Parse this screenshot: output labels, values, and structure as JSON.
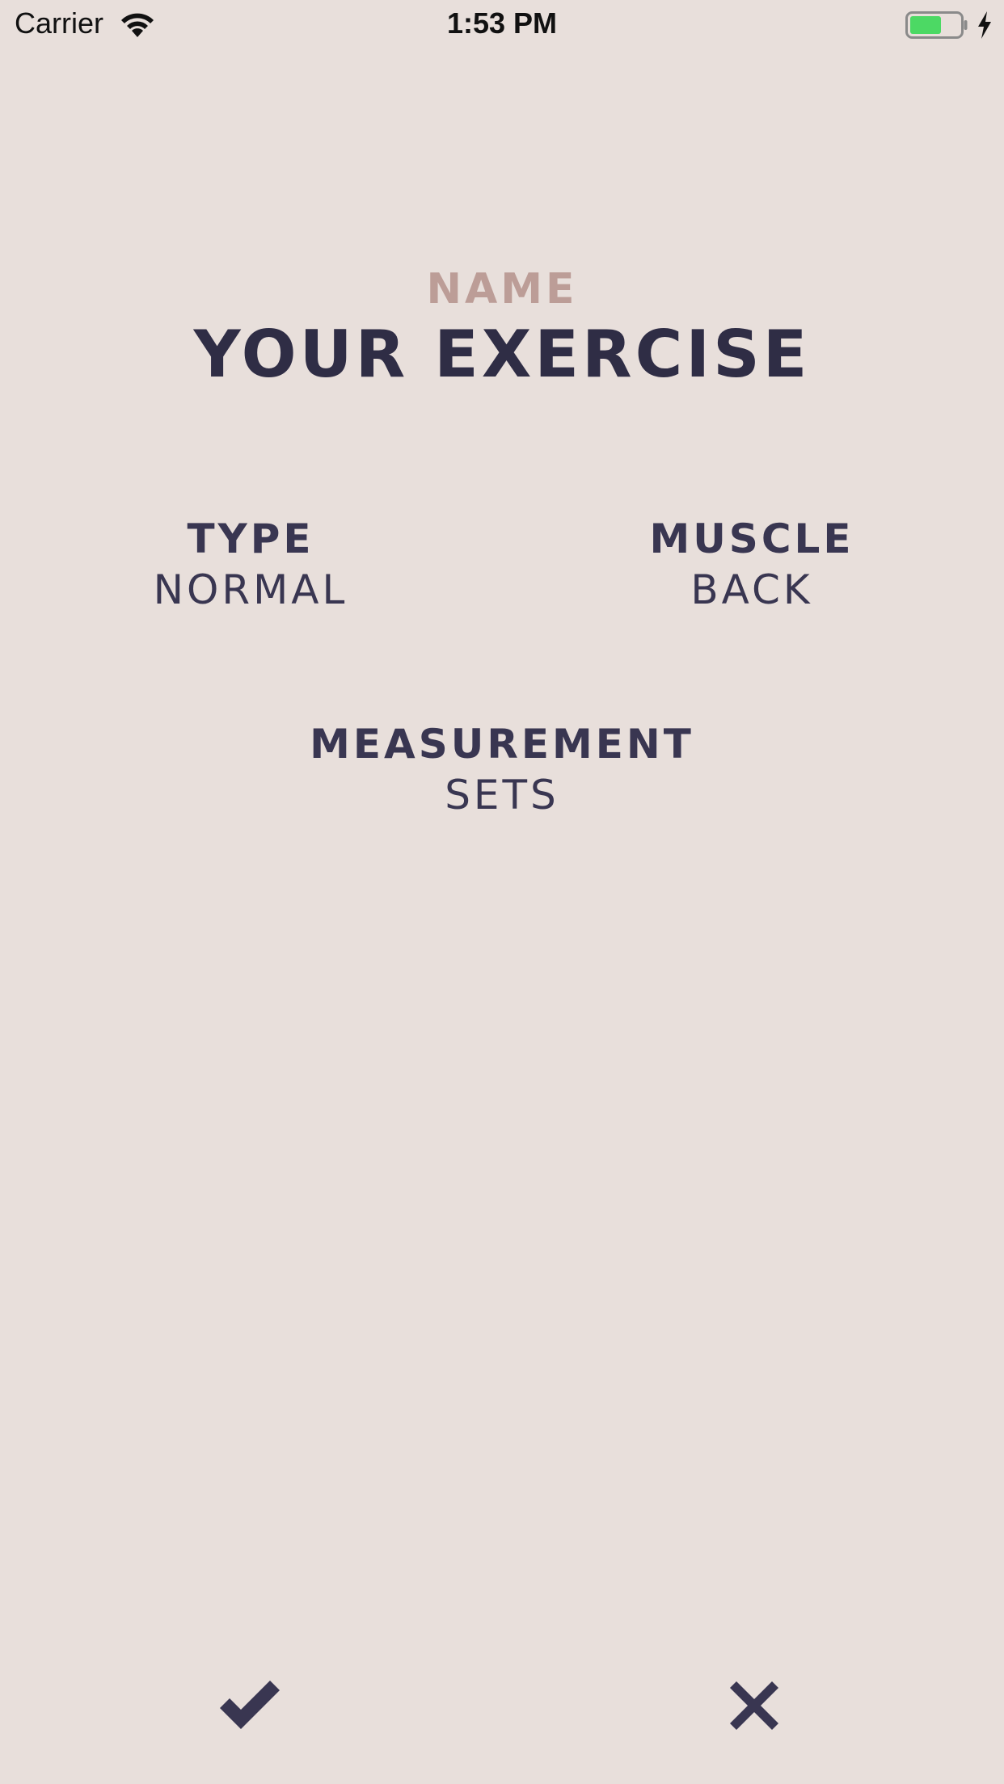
{
  "status_bar": {
    "carrier": "Carrier",
    "time": "1:53 PM",
    "battery_color": "#4cd964"
  },
  "exercise": {
    "name_label": "NAME",
    "name_value": "YOUR EXERCISE",
    "type_label": "TYPE",
    "type_value": "NORMAL",
    "muscle_label": "MUSCLE",
    "muscle_value": "BACK",
    "measurement_label": "MEASUREMENT",
    "measurement_value": "SETS"
  },
  "actions": {
    "confirm_icon": "checkmark-icon",
    "cancel_icon": "close-icon"
  },
  "colors": {
    "background": "#e8dfdb",
    "accent_label": "#bc9d97",
    "text": "#393651"
  }
}
